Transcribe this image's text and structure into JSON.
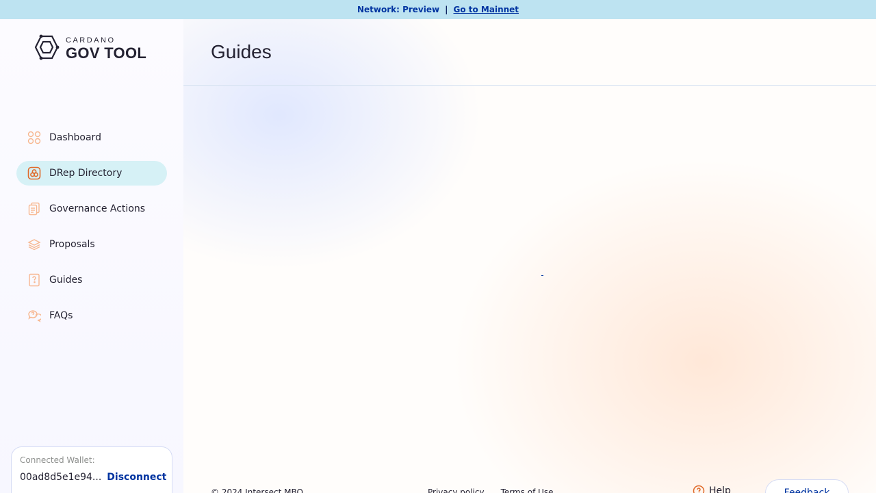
{
  "banner": {
    "network_label": "Network: Preview",
    "separator": "|",
    "mainnet_link": "Go to Mainnet"
  },
  "logo": {
    "small": "CARDANO",
    "big": "GOV TOOL"
  },
  "sidebar": {
    "items": [
      {
        "label": "Dashboard",
        "icon": "dashboard-icon"
      },
      {
        "label": "DRep Directory",
        "icon": "drep-icon",
        "active": true
      },
      {
        "label": "Governance Actions",
        "icon": "governance-actions-icon"
      },
      {
        "label": "Proposals",
        "icon": "proposals-icon"
      },
      {
        "label": "Guides",
        "icon": "guides-icon"
      },
      {
        "label": "FAQs",
        "icon": "faqs-icon"
      }
    ]
  },
  "wallet": {
    "label": "Connected Wallet:",
    "address": "00ad8d5e1e94...",
    "disconnect": "Disconnect"
  },
  "main": {
    "title": "Guides"
  },
  "footer": {
    "copyright": "© 2024 Intersect MBO",
    "privacy": "Privacy policy",
    "terms": "Terms of Use",
    "help": "Help",
    "feedback": "Feedback"
  },
  "colors": {
    "accent": "#0033a0",
    "icon_orange": "#f7a472",
    "icon_orange_active": "#e06a2a",
    "banner_bg": "#bde3f1",
    "active_nav_bg": "#d6f1f6"
  }
}
